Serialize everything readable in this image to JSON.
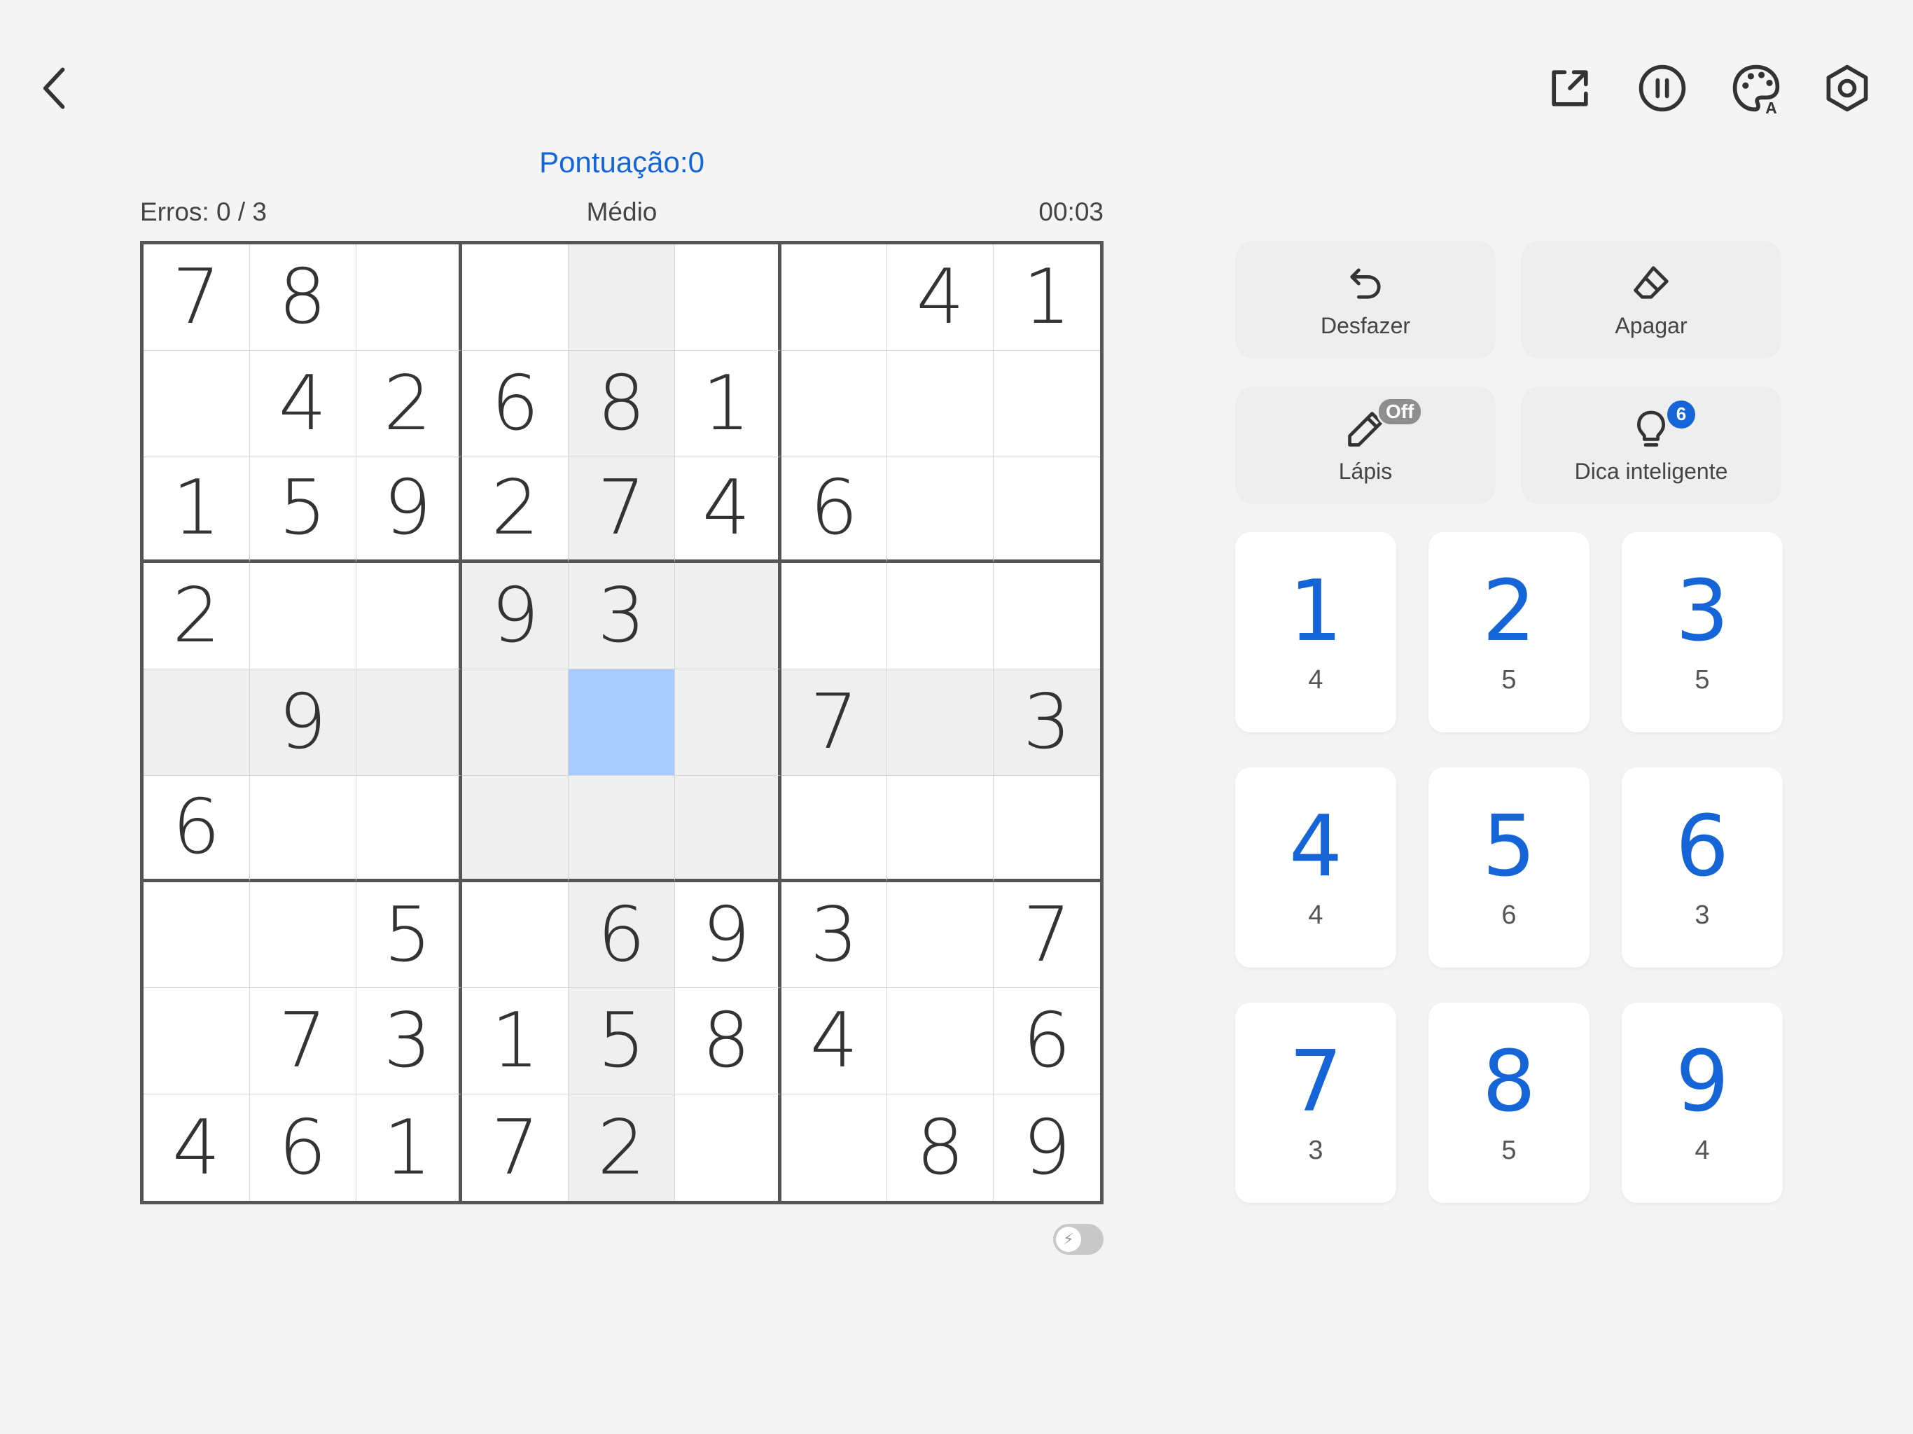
{
  "topbar": {
    "icons": [
      "back-icon",
      "share-icon",
      "pause-icon",
      "palette-icon",
      "settings-icon"
    ]
  },
  "header": {
    "score": "Pontuação:0",
    "errors": "Erros: 0 / 3",
    "difficulty": "Médio",
    "timer": "00:03"
  },
  "board": {
    "grid": [
      [
        "7",
        "8",
        "",
        "",
        "",
        "",
        "",
        "4",
        "1"
      ],
      [
        "",
        "4",
        "2",
        "6",
        "8",
        "1",
        "",
        "",
        ""
      ],
      [
        "1",
        "5",
        "9",
        "2",
        "7",
        "4",
        "6",
        "",
        ""
      ],
      [
        "2",
        "",
        "",
        "9",
        "3",
        "",
        "",
        "",
        ""
      ],
      [
        "",
        "9",
        "",
        "",
        "",
        "",
        "7",
        "",
        "3"
      ],
      [
        "6",
        "",
        "",
        "",
        "",
        "",
        "",
        "",
        ""
      ],
      [
        "",
        "",
        "5",
        "",
        "6",
        "9",
        "3",
        "",
        "7"
      ],
      [
        "",
        "7",
        "3",
        "1",
        "5",
        "8",
        "4",
        "",
        "6"
      ],
      [
        "4",
        "6",
        "1",
        "7",
        "2",
        "",
        "",
        "8",
        "9"
      ]
    ],
    "selected": {
      "row": 4,
      "col": 4
    }
  },
  "tools": {
    "undo": "Desfazer",
    "erase": "Apagar",
    "pencil": "Lápis",
    "pencil_badge": "Off",
    "hint": "Dica inteligente",
    "hint_badge": "6"
  },
  "keypad": [
    {
      "digit": "1",
      "count": "4"
    },
    {
      "digit": "2",
      "count": "5"
    },
    {
      "digit": "3",
      "count": "5"
    },
    {
      "digit": "4",
      "count": "4"
    },
    {
      "digit": "5",
      "count": "6"
    },
    {
      "digit": "6",
      "count": "3"
    },
    {
      "digit": "7",
      "count": "3"
    },
    {
      "digit": "8",
      "count": "5"
    },
    {
      "digit": "9",
      "count": "4"
    }
  ],
  "colors": {
    "accent": "#1565d8",
    "selected_cell": "#a9cbff",
    "highlight_cell": "#efefef",
    "background": "#f4f4f4"
  }
}
